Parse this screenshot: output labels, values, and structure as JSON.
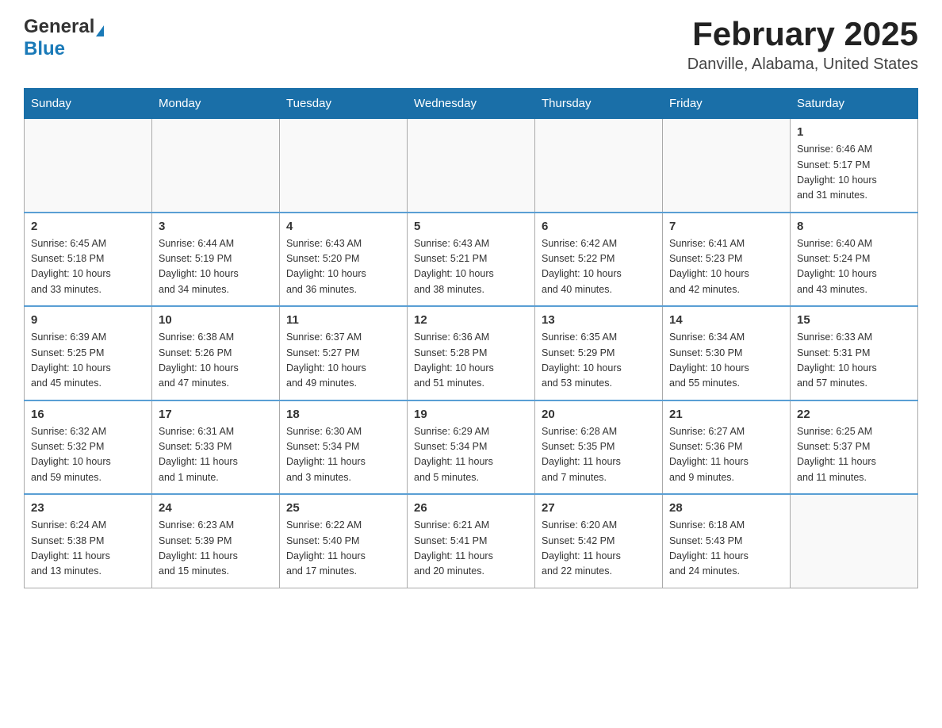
{
  "logo": {
    "general": "General",
    "triangle": "",
    "blue": "Blue"
  },
  "header": {
    "month": "February 2025",
    "location": "Danville, Alabama, United States"
  },
  "days_of_week": [
    "Sunday",
    "Monday",
    "Tuesday",
    "Wednesday",
    "Thursday",
    "Friday",
    "Saturday"
  ],
  "weeks": [
    [
      {
        "day": "",
        "info": ""
      },
      {
        "day": "",
        "info": ""
      },
      {
        "day": "",
        "info": ""
      },
      {
        "day": "",
        "info": ""
      },
      {
        "day": "",
        "info": ""
      },
      {
        "day": "",
        "info": ""
      },
      {
        "day": "1",
        "info": "Sunrise: 6:46 AM\nSunset: 5:17 PM\nDaylight: 10 hours\nand 31 minutes."
      }
    ],
    [
      {
        "day": "2",
        "info": "Sunrise: 6:45 AM\nSunset: 5:18 PM\nDaylight: 10 hours\nand 33 minutes."
      },
      {
        "day": "3",
        "info": "Sunrise: 6:44 AM\nSunset: 5:19 PM\nDaylight: 10 hours\nand 34 minutes."
      },
      {
        "day": "4",
        "info": "Sunrise: 6:43 AM\nSunset: 5:20 PM\nDaylight: 10 hours\nand 36 minutes."
      },
      {
        "day": "5",
        "info": "Sunrise: 6:43 AM\nSunset: 5:21 PM\nDaylight: 10 hours\nand 38 minutes."
      },
      {
        "day": "6",
        "info": "Sunrise: 6:42 AM\nSunset: 5:22 PM\nDaylight: 10 hours\nand 40 minutes."
      },
      {
        "day": "7",
        "info": "Sunrise: 6:41 AM\nSunset: 5:23 PM\nDaylight: 10 hours\nand 42 minutes."
      },
      {
        "day": "8",
        "info": "Sunrise: 6:40 AM\nSunset: 5:24 PM\nDaylight: 10 hours\nand 43 minutes."
      }
    ],
    [
      {
        "day": "9",
        "info": "Sunrise: 6:39 AM\nSunset: 5:25 PM\nDaylight: 10 hours\nand 45 minutes."
      },
      {
        "day": "10",
        "info": "Sunrise: 6:38 AM\nSunset: 5:26 PM\nDaylight: 10 hours\nand 47 minutes."
      },
      {
        "day": "11",
        "info": "Sunrise: 6:37 AM\nSunset: 5:27 PM\nDaylight: 10 hours\nand 49 minutes."
      },
      {
        "day": "12",
        "info": "Sunrise: 6:36 AM\nSunset: 5:28 PM\nDaylight: 10 hours\nand 51 minutes."
      },
      {
        "day": "13",
        "info": "Sunrise: 6:35 AM\nSunset: 5:29 PM\nDaylight: 10 hours\nand 53 minutes."
      },
      {
        "day": "14",
        "info": "Sunrise: 6:34 AM\nSunset: 5:30 PM\nDaylight: 10 hours\nand 55 minutes."
      },
      {
        "day": "15",
        "info": "Sunrise: 6:33 AM\nSunset: 5:31 PM\nDaylight: 10 hours\nand 57 minutes."
      }
    ],
    [
      {
        "day": "16",
        "info": "Sunrise: 6:32 AM\nSunset: 5:32 PM\nDaylight: 10 hours\nand 59 minutes."
      },
      {
        "day": "17",
        "info": "Sunrise: 6:31 AM\nSunset: 5:33 PM\nDaylight: 11 hours\nand 1 minute."
      },
      {
        "day": "18",
        "info": "Sunrise: 6:30 AM\nSunset: 5:34 PM\nDaylight: 11 hours\nand 3 minutes."
      },
      {
        "day": "19",
        "info": "Sunrise: 6:29 AM\nSunset: 5:34 PM\nDaylight: 11 hours\nand 5 minutes."
      },
      {
        "day": "20",
        "info": "Sunrise: 6:28 AM\nSunset: 5:35 PM\nDaylight: 11 hours\nand 7 minutes."
      },
      {
        "day": "21",
        "info": "Sunrise: 6:27 AM\nSunset: 5:36 PM\nDaylight: 11 hours\nand 9 minutes."
      },
      {
        "day": "22",
        "info": "Sunrise: 6:25 AM\nSunset: 5:37 PM\nDaylight: 11 hours\nand 11 minutes."
      }
    ],
    [
      {
        "day": "23",
        "info": "Sunrise: 6:24 AM\nSunset: 5:38 PM\nDaylight: 11 hours\nand 13 minutes."
      },
      {
        "day": "24",
        "info": "Sunrise: 6:23 AM\nSunset: 5:39 PM\nDaylight: 11 hours\nand 15 minutes."
      },
      {
        "day": "25",
        "info": "Sunrise: 6:22 AM\nSunset: 5:40 PM\nDaylight: 11 hours\nand 17 minutes."
      },
      {
        "day": "26",
        "info": "Sunrise: 6:21 AM\nSunset: 5:41 PM\nDaylight: 11 hours\nand 20 minutes."
      },
      {
        "day": "27",
        "info": "Sunrise: 6:20 AM\nSunset: 5:42 PM\nDaylight: 11 hours\nand 22 minutes."
      },
      {
        "day": "28",
        "info": "Sunrise: 6:18 AM\nSunset: 5:43 PM\nDaylight: 11 hours\nand 24 minutes."
      },
      {
        "day": "",
        "info": ""
      }
    ]
  ]
}
